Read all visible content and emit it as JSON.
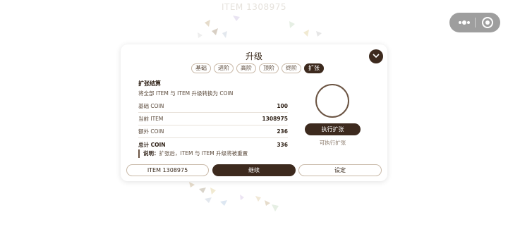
{
  "page": {
    "header_title": "ITEM 1308975"
  },
  "menu_capsule": {
    "more_icon": "more-dots-icon",
    "close_icon": "target-close-icon"
  },
  "dialog": {
    "title": "升级",
    "tabs": [
      {
        "label": "基础",
        "active": false
      },
      {
        "label": "进阶",
        "active": false
      },
      {
        "label": "高阶",
        "active": false
      },
      {
        "label": "顶阶",
        "active": false
      },
      {
        "label": "终阶",
        "active": false
      },
      {
        "label": "扩张",
        "active": true
      }
    ],
    "section_title": "扩张结算",
    "section_desc": "将全部 ITEM 与 ITEM 升级转换为 COIN",
    "rows": [
      {
        "label": "基础 COIN",
        "value": "100"
      },
      {
        "label": "当前 ITEM",
        "value": "1308975"
      },
      {
        "label": "额外 COIN",
        "value": "236"
      },
      {
        "label": "总计 COIN",
        "value": "336"
      }
    ],
    "note_label": "说明：",
    "note_text": "扩张后，ITEM 与 ITEM 升级将被重置",
    "execute_label": "执行扩张",
    "execute_hint": "可执行扩张",
    "footer": {
      "left_label": "ITEM 1308975",
      "center_label": "继续",
      "right_label": "设定"
    }
  },
  "colors": {
    "accent": "#3d2a1e",
    "border": "#c9b9a8",
    "text": "#3a2a1c"
  }
}
